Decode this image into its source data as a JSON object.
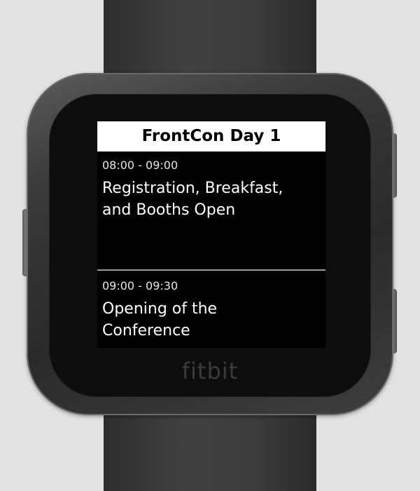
{
  "device": {
    "brand": "fitbit"
  },
  "screen": {
    "title": "FrontCon Day 1",
    "events": [
      {
        "time": "08:00 - 09:00",
        "name_line1": "Registration, Breakfast,",
        "name_line2": "and Booths Open"
      },
      {
        "time": "09:00 - 09:30",
        "name_line1": "Opening of the",
        "name_line2": "Conference"
      }
    ]
  }
}
